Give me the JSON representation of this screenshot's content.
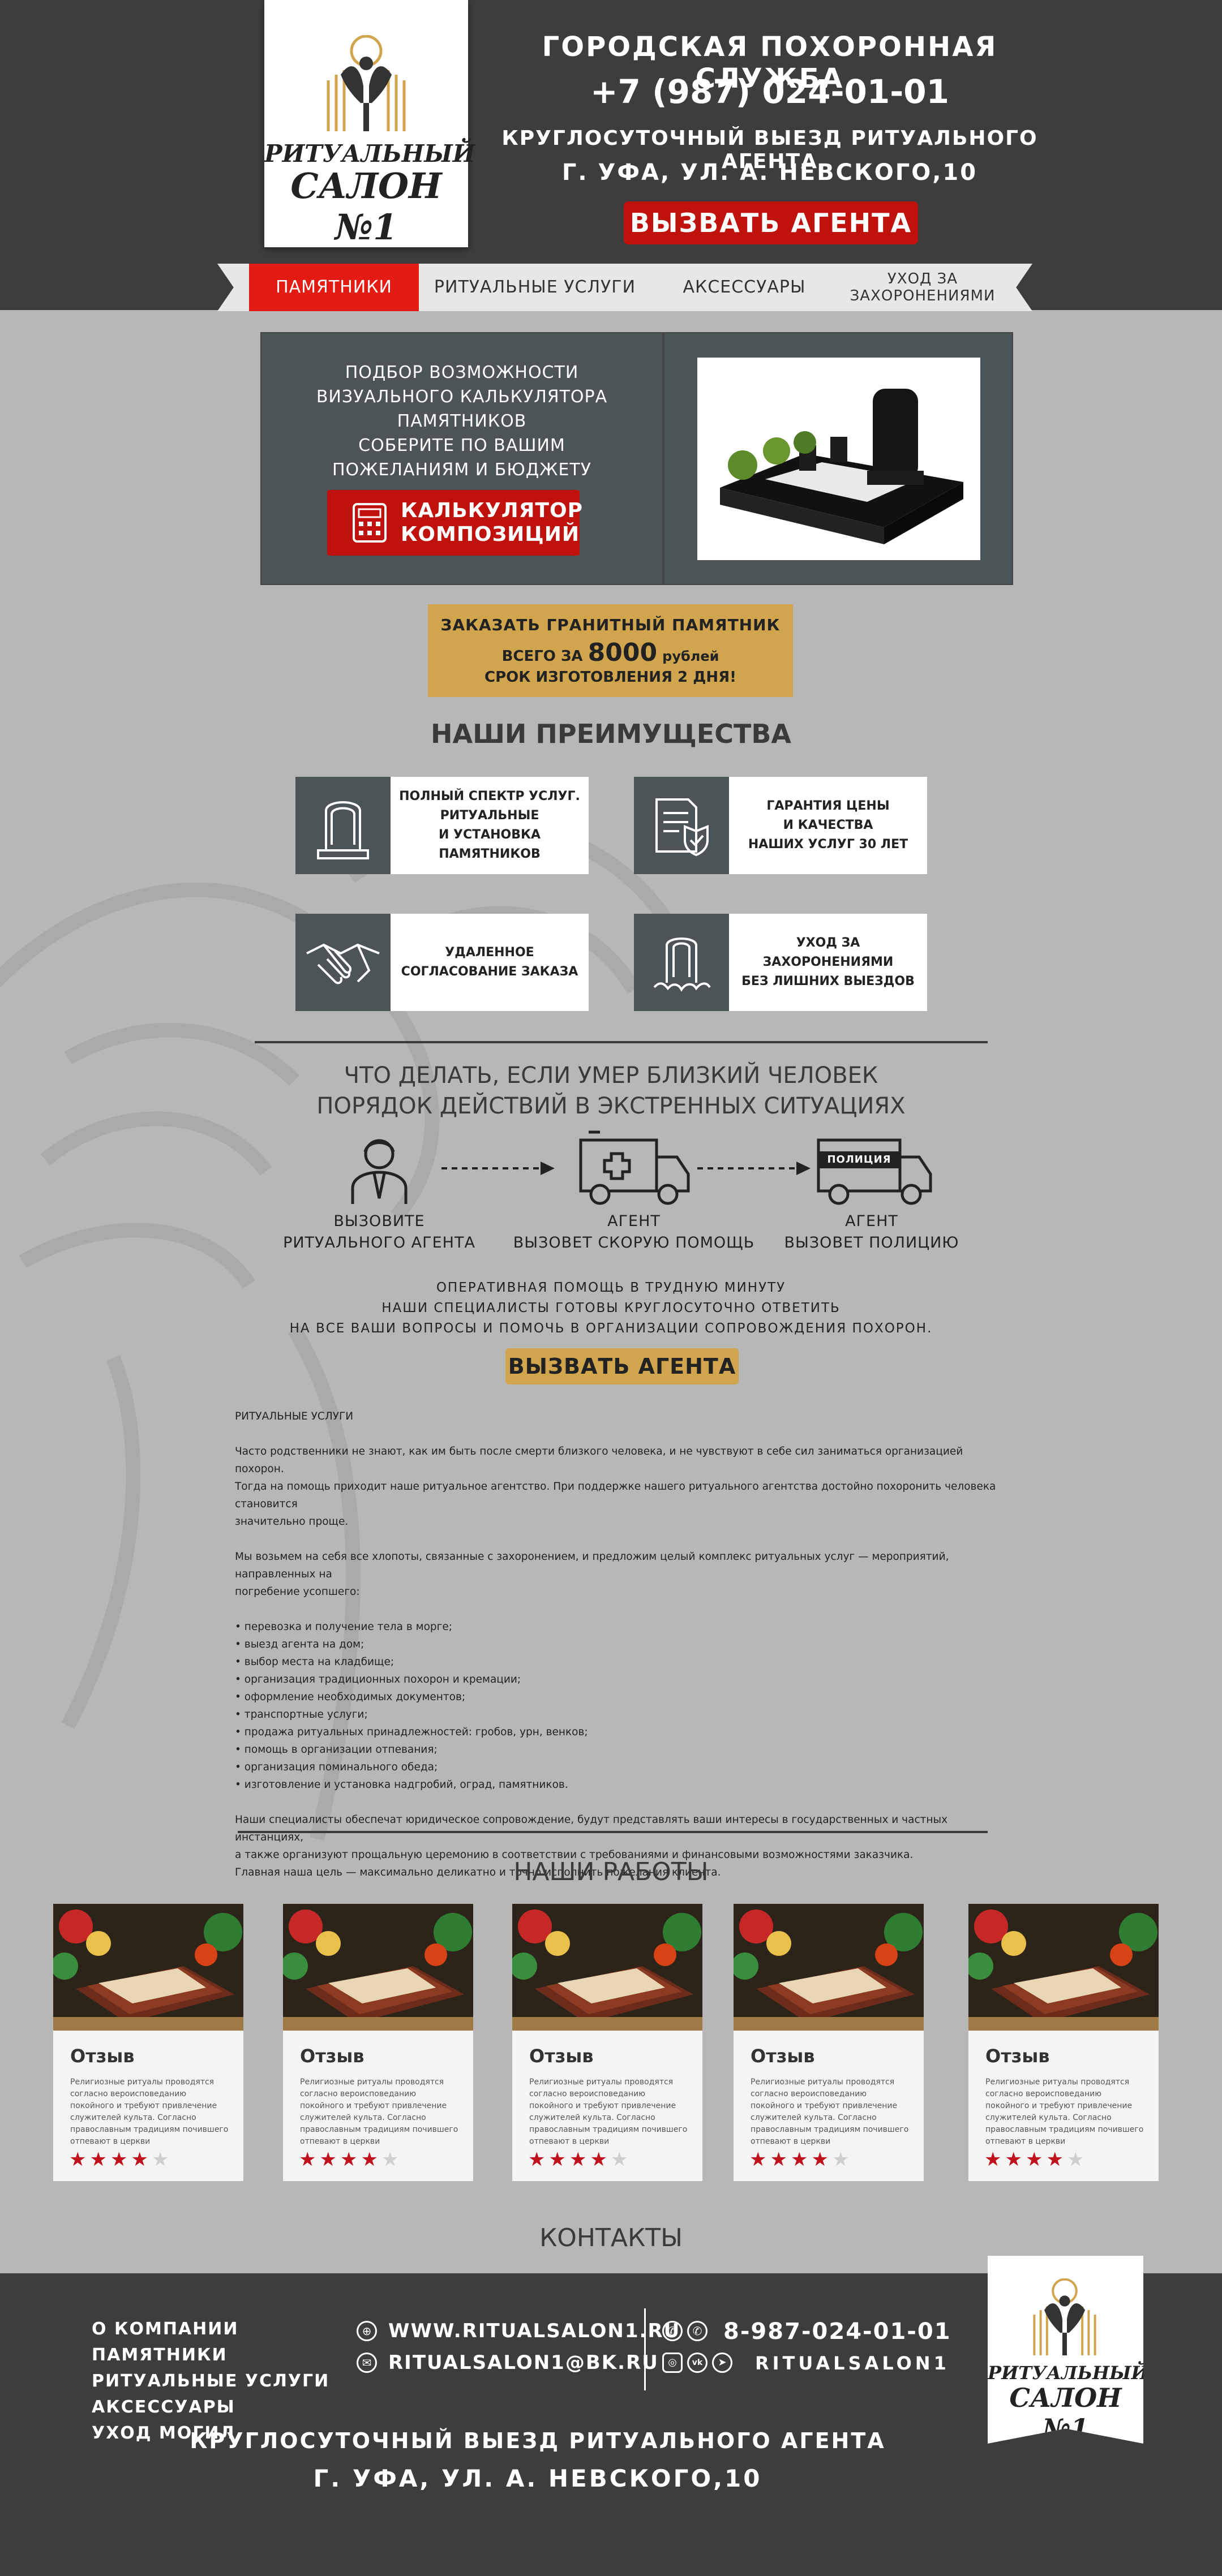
{
  "header": {
    "line1": "ГОРОДСКАЯ ПОХОРОННАЯ СЛУЖБА",
    "phone": "+7 (987) 024-01-01",
    "line3": "КРУГЛОСУТОЧНЫЙ ВЫЕЗД РИТУАЛЬНОГО АГЕНТА",
    "address": "Г. УФА, УЛ. А. НЕВСКОГО,10",
    "cta": "ВЫЗВАТЬ АГЕНТА"
  },
  "logo": {
    "line1": "РИТУАЛЬНЫЙ",
    "line2": "САЛОН №1"
  },
  "nav": [
    {
      "label": "ПАМЯТНИКИ",
      "active": true
    },
    {
      "label": "РИТУАЛЬНЫЕ УСЛУГИ",
      "active": false
    },
    {
      "label": "АКСЕССУАРЫ",
      "active": false
    },
    {
      "label": "УХОД ЗА ЗАХОРОНЕНИЯМИ",
      "active": false
    }
  ],
  "calculator": {
    "l1": "ПОДБОР ВОЗМОЖНОСТИ",
    "l2": "ВИЗУАЛЬНОГО КАЛЬКУЛЯТОРА",
    "l3": "ПАМЯТНИКОВ",
    "l4": "СОБЕРИТЕ ПО ВАШИМ",
    "l5": "ПОЖЕЛАНИЯМ И БЮДЖЕТУ",
    "button_l1": "КАЛЬКУЛЯТОР",
    "button_l2": "КОМПОЗИЦИЙ"
  },
  "offer": {
    "l1": "ЗАКАЗАТЬ ГРАНИТНЫЙ ПАМЯТНИК",
    "l2_pre": "ВСЕГО ЗА",
    "price": "8000",
    "l2_post": "рублей",
    "l3": "СРОК ИЗГОТОВЛЕНИЯ 2 ДНЯ!"
  },
  "advantages": {
    "title": "НАШИ ПРЕИМУЩЕСТВА",
    "items": [
      {
        "l1": "ПОЛНЫЙ СПЕКТР УСЛУГ.",
        "l2": "РИТУАЛЬНЫЕ",
        "l3": "И УСТАНОВКА ПАМЯТНИКОВ",
        "icon": "monument-icon"
      },
      {
        "l1": "ГАРАНТИЯ ЦЕНЫ",
        "l2": "И КАЧЕСТВА",
        "l3": "НАШИХ УСЛУГ 30 ЛЕТ",
        "icon": "guarantee-icon"
      },
      {
        "l1": "УДАЛЕННОЕ",
        "l2": "СОГЛАСОВАНИЕ ЗАКАЗА",
        "l3": "",
        "icon": "handshake-icon"
      },
      {
        "l1": "УХОД ЗА ЗАХОРОНЕНИЯМИ",
        "l2": "БЕЗ ЛИШНИХ ВЫЕЗДОВ",
        "l3": "",
        "icon": "grave-care-icon"
      }
    ]
  },
  "steps": {
    "title1": "ЧТО ДЕЛАТЬ, ЕСЛИ УМЕР БЛИЗКИЙ ЧЕЛОВЕК",
    "title2": "ПОРЯДОК ДЕЙСТВИЙ В ЭКСТРЕННЫХ СИТУАЦИЯХ",
    "items": [
      {
        "l1": "ВЫЗОВИТЕ",
        "l2": "РИТУАЛЬНОГО АГЕНТА"
      },
      {
        "l1": "АГЕНТ",
        "l2": "ВЫЗОВЕТ СКОРУЮ ПОМОЩЬ"
      },
      {
        "l1": "АГЕНТ",
        "l2": "ВЫЗОВЕТ ПОЛИЦИЮ"
      }
    ],
    "police_label": "ПОЛИЦИЯ",
    "info1": "ОПЕРАТИВНАЯ ПОМОЩЬ В ТРУДНУЮ МИНУТУ",
    "info2": "НАШИ СПЕЦИАЛИСТЫ ГОТОВЫ КРУГЛОСУТОЧНО ОТВЕТИТЬ",
    "info3": "НА ВСЕ ВАШИ ВОПРОСЫ И ПОМОЧЬ В ОРГАНИЗАЦИИ СОПРОВОЖДЕНИЯ ПОХОРОН.",
    "cta": "ВЫЗВАТЬ АГЕНТА"
  },
  "article": {
    "heading": "РИТУАЛЬНЫЕ УСЛУГИ",
    "p1a": "Часто родственники не знают, как им быть после смерти близкого человека, и не чувствуют в себе сил заниматься организацией похорон.",
    "p1b": "Тогда на помощь приходит наше ритуальное агентство. При поддержке нашего ритуального агентства достойно похоронить человека становится",
    "p1c": "значительно проще.",
    "p2a": "Мы возьмем на себя все хлопоты, связанные с захоронением, и предложим целый комплекс ритуальных услуг — мероприятий, направленных на",
    "p2b": "погребение усопшего:",
    "list": [
      "• перевозка и получение тела в морге;",
      "• выезд агента на дом;",
      "• выбор места на кладбище;",
      "• организация традиционных похорон и кремации;",
      "• оформление необходимых документов;",
      "• транспортные услуги;",
      "• продажа ритуальных принадлежностей: гробов, урн, венков;",
      "• помощь в организации отпевания;",
      "• организация поминального обеда;",
      "• изготовление и установка надгробий, оград, памятников."
    ],
    "p3a": "Наши специалисты обеспечат юридическое сопровождение, будут представлять ваши интересы в государственных и частных инстанциях,",
    "p3b": "а также организуют прощальную церемонию в соответствии с требованиями и финансовыми возможностями заказчика.",
    "p3c": "Главная наша цель — максимально деликатно и точно исполнить пожелания клиента."
  },
  "works": {
    "title": "НАШИ РАБОТЫ",
    "review_title": "Отзыв",
    "review_text": "Религиозные ритуалы проводятся согласно вероисповеданию покойного и требуют привлечение служителей культа. Согласно православным традициям почившего отпевают в церкви",
    "rating": 4,
    "rating_max": 5,
    "count": 5
  },
  "contacts": {
    "title": "КОНТАКТЫ",
    "menu": [
      "О КОМПАНИИ",
      "ПАМЯТНИКИ",
      "РИТУАЛЬНЫЕ УСЛУГИ",
      "АКСЕССУАРЫ",
      "УХОД МОГИЛ"
    ],
    "site": "WWW.RITUALSALON1.RU",
    "email": "RITUALSALON1@BK.RU",
    "phone": "8-987-024-01-01",
    "social": "RITUALSALON1",
    "bottom1": "КРУГЛОСУТОЧНЫЙ ВЫЕЗД РИТУАЛЬНОГО АГЕНТА",
    "bottom2": "Г. УФА, УЛ. А. НЕВСКОГО,10"
  },
  "colors": {
    "accent_red": "#c0120c",
    "gold": "#d1a54e",
    "dark": "#3d3d3d",
    "panel": "#4c5457",
    "background": "#b7b7b7"
  }
}
